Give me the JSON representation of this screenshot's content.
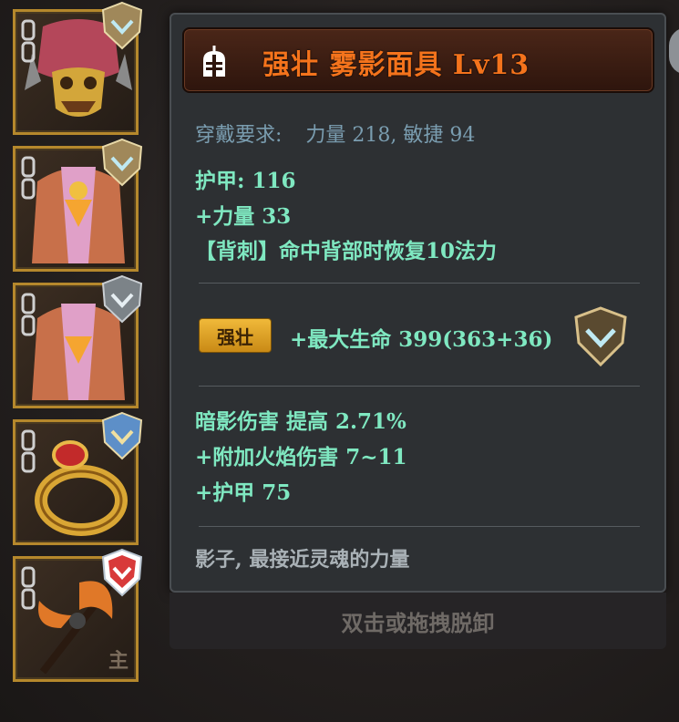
{
  "slots": [
    {
      "name": "helmet-slot",
      "badge": "silver-shield"
    },
    {
      "name": "armor-slot",
      "badge": "silver-shield"
    },
    {
      "name": "armor-slot-2",
      "badge": "gray-shield"
    },
    {
      "name": "ring-slot",
      "badge": "blue-shield"
    },
    {
      "name": "weapon-slot",
      "badge": "red-shield",
      "tag": "主"
    }
  ],
  "tooltip": {
    "title": "强壮  雾影面具  Lv13",
    "requirement_label": "穿戴要求:",
    "requirement_value": "力量 218, 敏捷 94",
    "base_stats": [
      "护甲:  116",
      "+力量  33",
      "【背刺】命中背部时恢复10法力"
    ],
    "gem_tag": "强壮",
    "gem_stat": "+最大生命  399(363+36)",
    "extra_stats": [
      "暗影伤害  提高  2.71%",
      "+附加火焰伤害  7~11",
      "+护甲  75"
    ],
    "flavor": "影子, 最接近灵魂的力量"
  },
  "unequip_hint": "双击或拖拽脱卸",
  "colors": {
    "title": "#f4731c",
    "stat": "#7fe8c1",
    "requirement": "#7a9db0",
    "slot_border": "#b5882c"
  }
}
